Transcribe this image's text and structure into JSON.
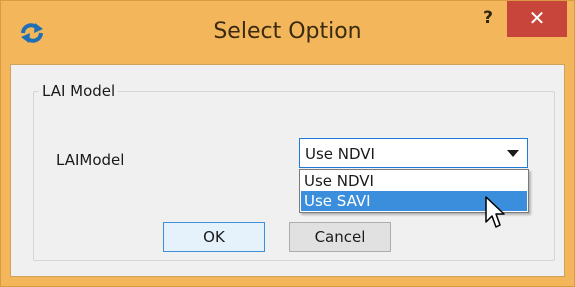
{
  "window": {
    "title": "Select Option",
    "help_label": "?",
    "close_label": "✕",
    "accent_color": "#f3b65a",
    "close_color": "#c7453b"
  },
  "group": {
    "legend": "LAI Model"
  },
  "form": {
    "field_label": "LAIModel",
    "combo_value": "Use NDVI",
    "options": [
      "Use NDVI",
      "Use SAVI"
    ],
    "highlighted_option": "Use SAVI"
  },
  "buttons": {
    "ok_label": "OK",
    "cancel_label": "Cancel"
  },
  "icons": {
    "app": "app-icon",
    "help": "help-icon",
    "close": "close-icon",
    "dropdown": "chevron-down-icon",
    "cursor": "mouse-pointer-icon"
  }
}
